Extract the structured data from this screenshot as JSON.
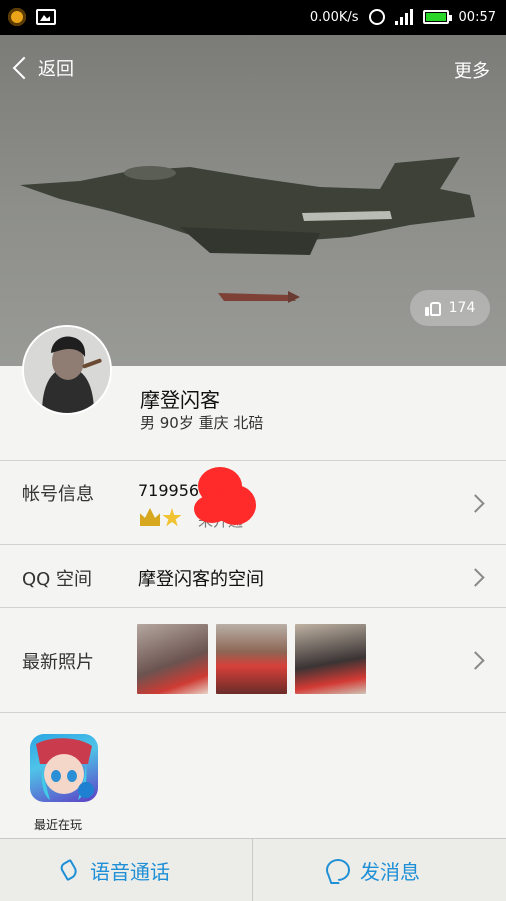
{
  "status_bar": {
    "speed": "0.00K/s",
    "time": "00:57",
    "icons": [
      "sun-icon",
      "gallery-icon",
      "alarm-icon",
      "signal-icon",
      "battery-icon"
    ]
  },
  "nav": {
    "back_label": "返回",
    "more_label": "更多"
  },
  "hero": {
    "likes": "174"
  },
  "profile": {
    "name": "摩登闪客",
    "info": "男 90岁 重庆 北碚"
  },
  "account": {
    "label": "帐号信息",
    "number": "7199564",
    "status": "未开通"
  },
  "qzone": {
    "label": "QQ 空间",
    "value": "摩登闪客的空间"
  },
  "photos": {
    "label": "最新照片"
  },
  "recent": {
    "label": "最近在玩"
  },
  "bottom_bar": {
    "call_label": "语音通话",
    "message_label": "发消息",
    "accent": "#1f8fd6"
  }
}
